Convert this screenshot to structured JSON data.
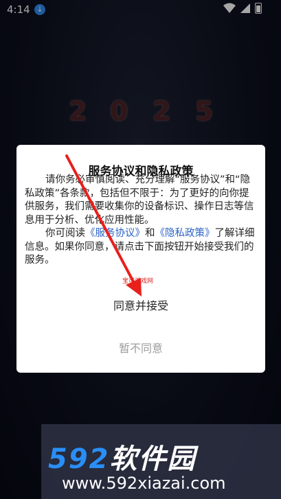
{
  "status_bar": {
    "time": "4:14"
  },
  "background": {
    "year_digits": [
      "2",
      "0",
      "2",
      "5"
    ]
  },
  "dialog": {
    "title": "服务协议和隐私政策",
    "para1": "请你务必审慎阅读、充分理解“服务协议”和“隐私政策”各条款，包括但不限于：为了更好的向你提供服务，我们需要收集你的设备标识、操作日志等信息用于分析、优化应用性能。",
    "para2_prefix": "你可阅读",
    "service_link": "《服务协议》",
    "and": "和",
    "privacy_link": "《隐私政策》",
    "para2_suffix": "了解详细信息。如果你同意，请点击下面按钮开始接受我们的服务。",
    "watermark": "宝可游戏网",
    "accept_label": "同意并接受",
    "decline_label": "暂不同意"
  },
  "branding": {
    "logo_num": "592",
    "logo_text": "软件园",
    "url": "www.592xiazai.com"
  },
  "colors": {
    "link": "#2b63c6",
    "arrow": "#e8201c",
    "brand_accent": "#2a8ef6"
  }
}
